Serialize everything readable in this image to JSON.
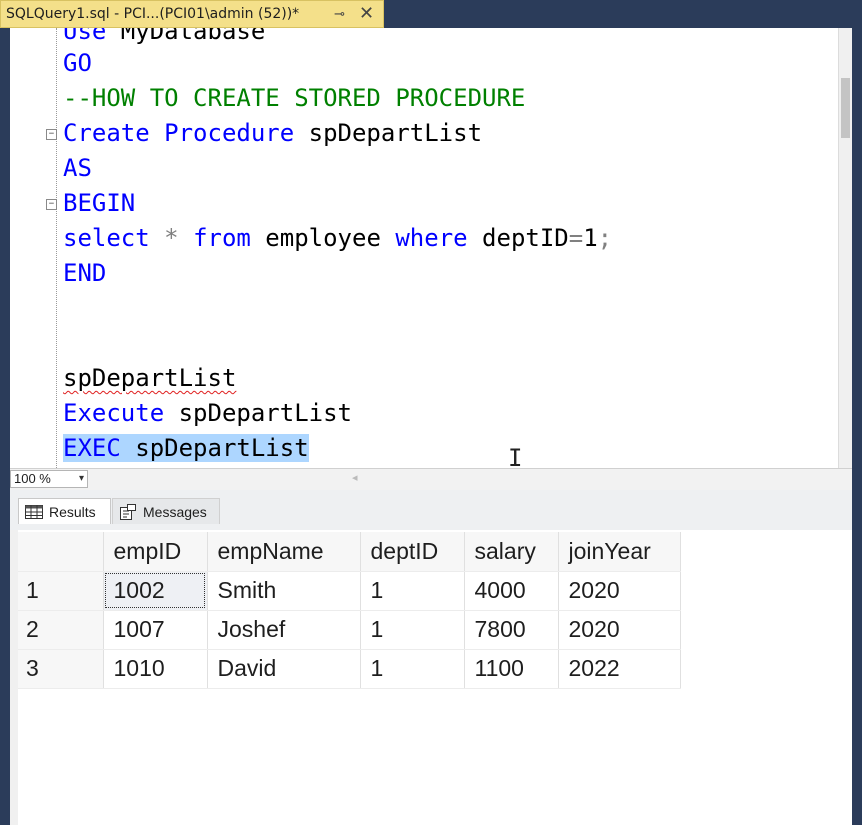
{
  "tab": {
    "title": "SQLQuery1.sql - PCI...(PCI01\\admin (52))*",
    "pin_icon": "⊸",
    "close_icon": "✕"
  },
  "editor": {
    "line0": {
      "kw": "Use",
      "rest": " MyDatabase"
    },
    "line1": {
      "kw": "GO"
    },
    "line2": {
      "comment": "--HOW TO CREATE STORED PROCEDURE"
    },
    "line3": {
      "kw": "Create Procedure",
      "rest": " spDepartList"
    },
    "line4": {
      "kw": "AS"
    },
    "line5": {
      "kw": "BEGIN"
    },
    "line6": {
      "kw1": "select",
      "op1": " * ",
      "kw2": "from",
      "mid": " employee ",
      "kw3": "where",
      "rest": " deptID",
      "op2": "=",
      "num": "1",
      "semi": ";"
    },
    "line7": {
      "kw": "END"
    },
    "line8": {
      "squiggle": "spDepartList"
    },
    "line9": {
      "kw": "Execute",
      "rest": " spDepartList"
    },
    "line10": {
      "kw": "EXEC",
      "rest": " spDepartList"
    },
    "fold_marker": "−"
  },
  "zoom": {
    "value": "100 %",
    "arrow": "▾"
  },
  "results_tabs": {
    "results": "Results",
    "messages": "Messages"
  },
  "grid": {
    "columns": [
      "empID",
      "empName",
      "deptID",
      "salary",
      "joinYear"
    ],
    "rows": [
      {
        "n": "1",
        "cells": [
          "1002",
          "Smith",
          "1",
          "4000",
          "2020"
        ]
      },
      {
        "n": "2",
        "cells": [
          "1007",
          "Joshef",
          "1",
          "7800",
          "2020"
        ]
      },
      {
        "n": "3",
        "cells": [
          "1010",
          "David",
          "1",
          "1100",
          "2022"
        ]
      }
    ]
  },
  "colors": {
    "keyword": "#0000ff",
    "comment": "#008000",
    "selection": "#add6ff",
    "tab": "#f4e08a",
    "frame": "#2b3c5a"
  }
}
